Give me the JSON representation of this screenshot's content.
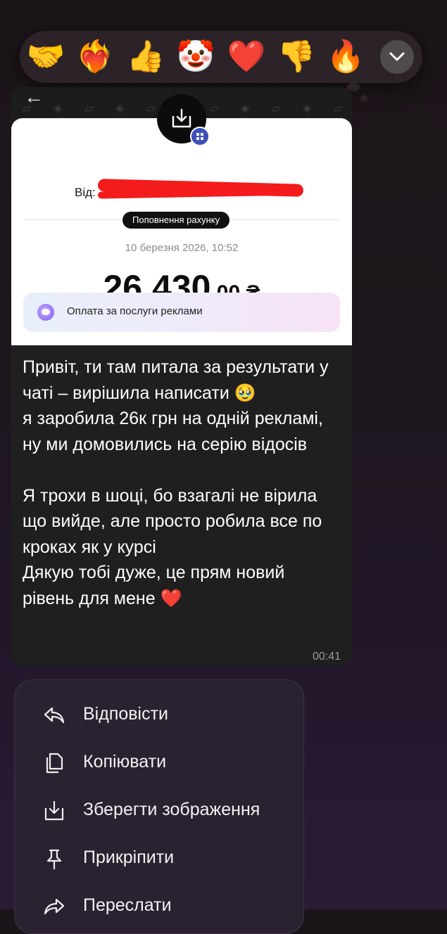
{
  "reactions": {
    "items": [
      {
        "emoji": "🤝",
        "name": "handshake"
      },
      {
        "emoji": "❤️‍🔥",
        "name": "heart-on-fire"
      },
      {
        "emoji": "👍",
        "name": "thumbs-up"
      },
      {
        "emoji": "🤡",
        "name": "clown"
      },
      {
        "emoji": "❤️",
        "name": "heart"
      },
      {
        "emoji": "👎",
        "name": "thumbs-down"
      },
      {
        "emoji": "🔥",
        "name": "fire"
      }
    ],
    "more_icon": "chevron-down-icon"
  },
  "receipt": {
    "from_label": "Від:",
    "from_redacted": true,
    "type_pill": "Поповнення рахунку",
    "date": "10 березня 2026, 10:52",
    "amount_main": "26 430",
    "amount_cents": ".00 ₴",
    "purpose": "Оплата за послуги реклами"
  },
  "message": {
    "text": "Привіт, ти там питала за результати у чаті – вирішила написати 🥹\nя заробила 26к грн на одній рекламі, ну ми домовились на серію відосів\n\nЯ трохи в шоці, бо взагалі не вірила що вийде, але просто робила все по кроках як у курсі\nДякую тобі дуже, це прям новий рівень для мене ❤️",
    "time": "00:41"
  },
  "context_menu": {
    "items": [
      {
        "label": "Відповісти",
        "icon": "reply-icon"
      },
      {
        "label": "Копіювати",
        "icon": "copy-icon"
      },
      {
        "label": "Зберегти зображення",
        "icon": "save-image-icon"
      },
      {
        "label": "Прикріпити",
        "icon": "pin-icon"
      },
      {
        "label": "Переслати",
        "icon": "forward-icon"
      }
    ]
  }
}
